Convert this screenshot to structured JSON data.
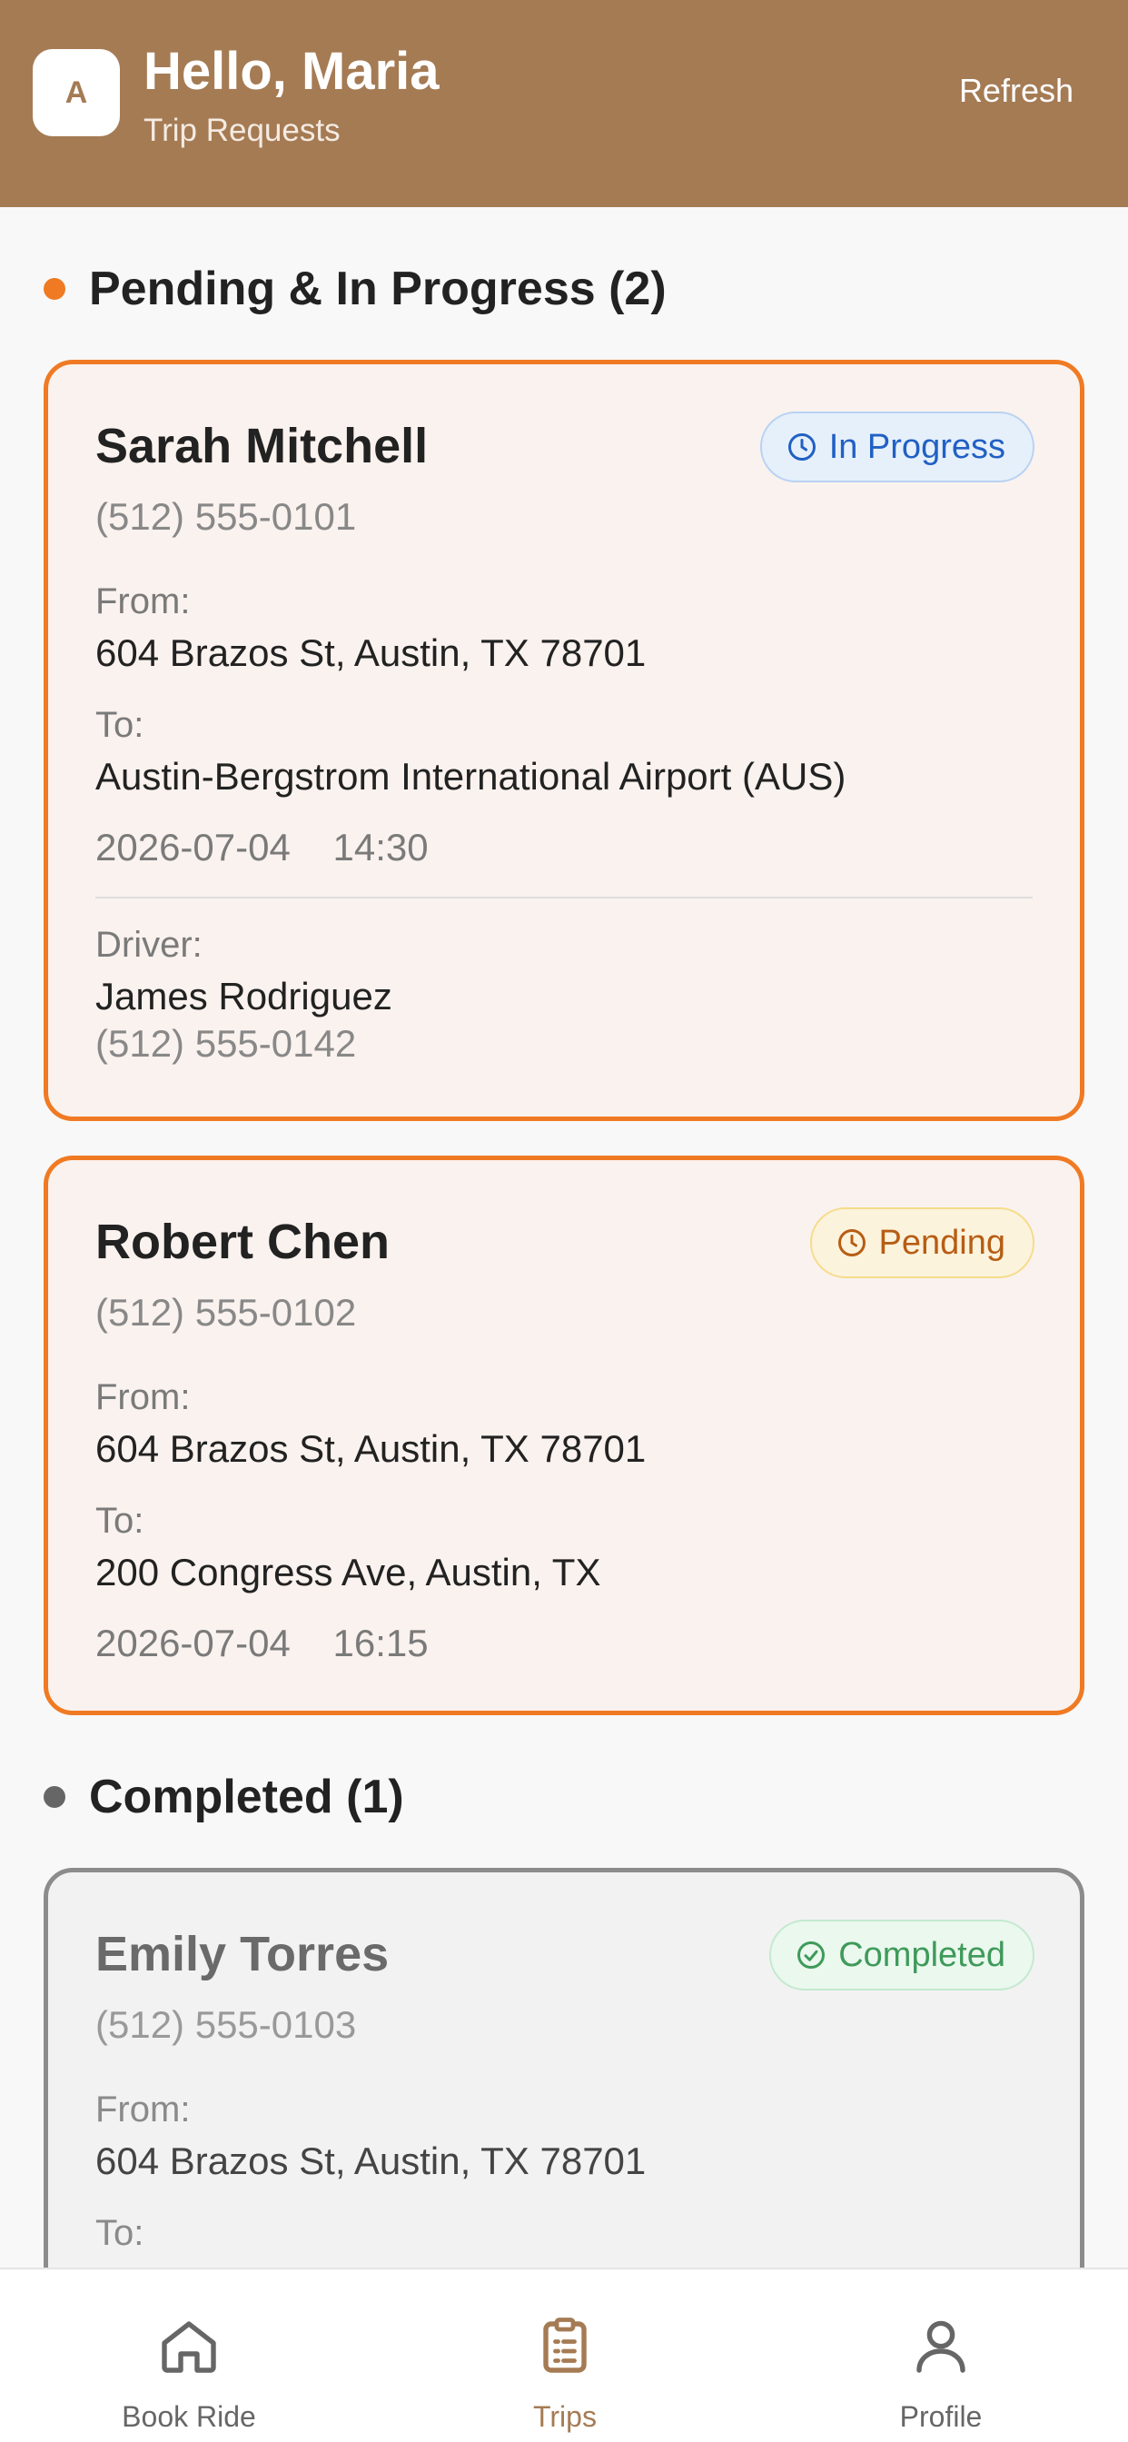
{
  "header": {
    "avatar_letter": "A",
    "greeting": "Hello, Maria",
    "subtitle": "Trip Requests",
    "refresh_label": "Refresh"
  },
  "sections": {
    "active": {
      "title": "Pending & In Progress (2)"
    },
    "completed": {
      "title": "Completed (1)"
    }
  },
  "trips": [
    {
      "name": "Sarah Mitchell",
      "phone": "(512) 555-0101",
      "status": "In Progress",
      "from_label": "From:",
      "from": "604 Brazos St, Austin, TX 78701",
      "to_label": "To:",
      "to": "Austin-Bergstrom International Airport (AUS)",
      "datetime": "2026-07-04    14:30",
      "driver_label": "Driver:",
      "driver_name": "James Rodriguez",
      "driver_phone": "(512) 555-0142"
    },
    {
      "name": "Robert Chen",
      "phone": "(512) 555-0102",
      "status": "Pending",
      "from_label": "From:",
      "from": "604 Brazos St, Austin, TX 78701",
      "to_label": "To:",
      "to": "200 Congress Ave, Austin, TX",
      "datetime": "2026-07-04    16:15"
    },
    {
      "name": "Emily Torres",
      "phone": "(512) 555-0103",
      "status": "Completed",
      "from_label": "From:",
      "from": "604 Brazos St, Austin, TX 78701",
      "to_label": "To:"
    }
  ],
  "nav": {
    "items": [
      {
        "label": "Book Ride",
        "icon": "home-icon"
      },
      {
        "label": "Trips",
        "icon": "clipboard-icon",
        "active": true
      },
      {
        "label": "Profile",
        "icon": "user-icon"
      }
    ]
  },
  "colors": {
    "header": "#a57b54",
    "accent": "#f07a23",
    "in_progress": "#2160c4",
    "pending": "#b75d14",
    "completed": "#3f9a5a"
  }
}
